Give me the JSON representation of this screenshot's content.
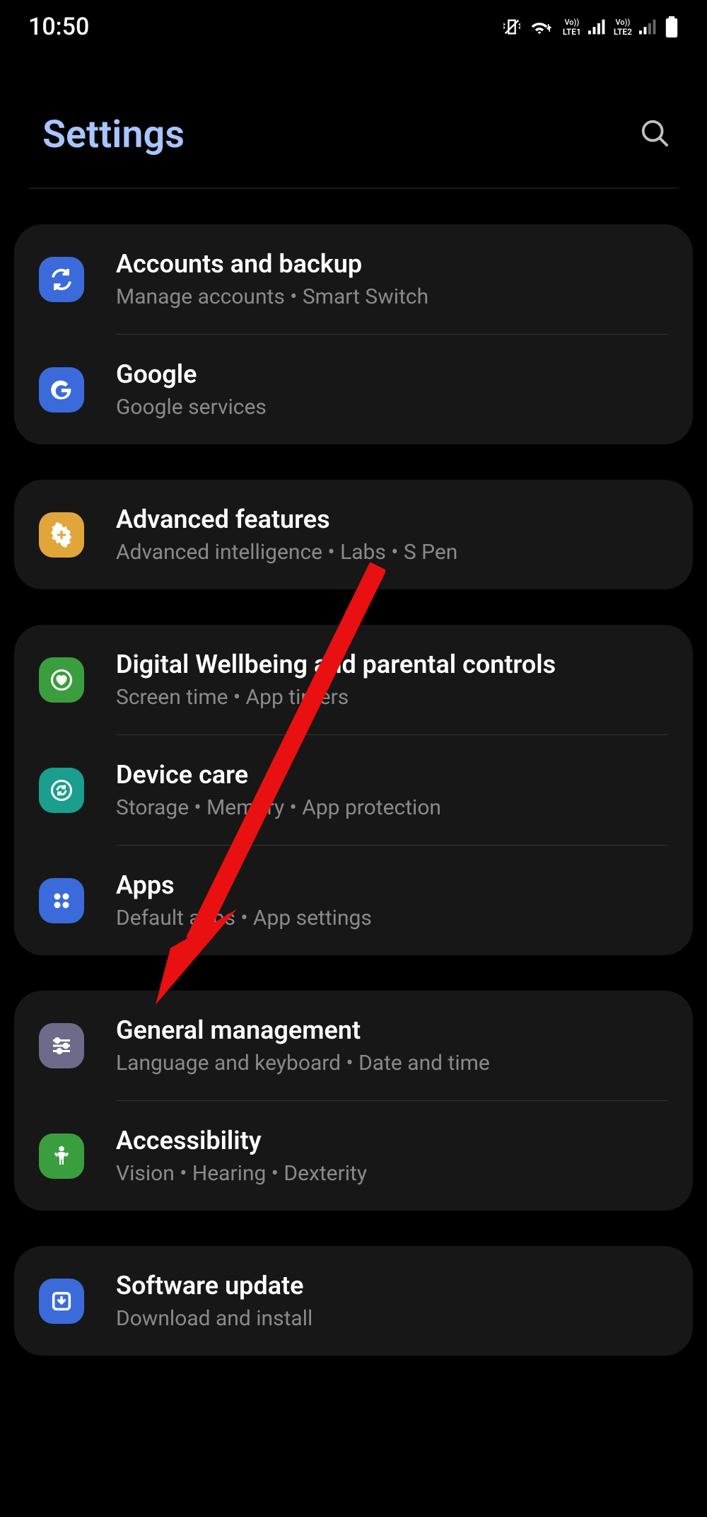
{
  "status": {
    "time": "10:50",
    "sim1": "LTE1",
    "sim2": "LTE2",
    "vo": "Vo))"
  },
  "header": {
    "title": "Settings"
  },
  "groups": [
    {
      "items": [
        {
          "id": "accounts",
          "title": "Accounts and backup",
          "sub": "Manage accounts  •  Smart Switch",
          "iconClass": "ic-sync",
          "icon": "sync"
        },
        {
          "id": "google",
          "title": "Google",
          "sub": "Google services",
          "iconClass": "ic-google",
          "icon": "google"
        }
      ]
    },
    {
      "items": [
        {
          "id": "advanced",
          "title": "Advanced features",
          "sub": "Advanced intelligence  •  Labs  •  S Pen",
          "iconClass": "ic-adv",
          "icon": "plus"
        }
      ]
    },
    {
      "items": [
        {
          "id": "wellbeing",
          "title": "Digital Wellbeing and parental controls",
          "sub": "Screen time  •  App timers",
          "iconClass": "ic-well",
          "icon": "heart"
        },
        {
          "id": "devicecare",
          "title": "Device care",
          "sub": "Storage  •  Memory  •  App protection",
          "iconClass": "ic-care",
          "icon": "refresh"
        },
        {
          "id": "apps",
          "title": "Apps",
          "sub": "Default apps  •  App settings",
          "iconClass": "ic-apps",
          "icon": "dots"
        }
      ]
    },
    {
      "items": [
        {
          "id": "general",
          "title": "General management",
          "sub": "Language and keyboard  •  Date and time",
          "iconClass": "ic-gen",
          "icon": "sliders"
        },
        {
          "id": "accessibility",
          "title": "Accessibility",
          "sub": "Vision  •  Hearing  •  Dexterity",
          "iconClass": "ic-acc",
          "icon": "person"
        }
      ]
    },
    {
      "items": [
        {
          "id": "software",
          "title": "Software update",
          "sub": "Download and install",
          "iconClass": "ic-sw",
          "icon": "download"
        }
      ]
    }
  ]
}
